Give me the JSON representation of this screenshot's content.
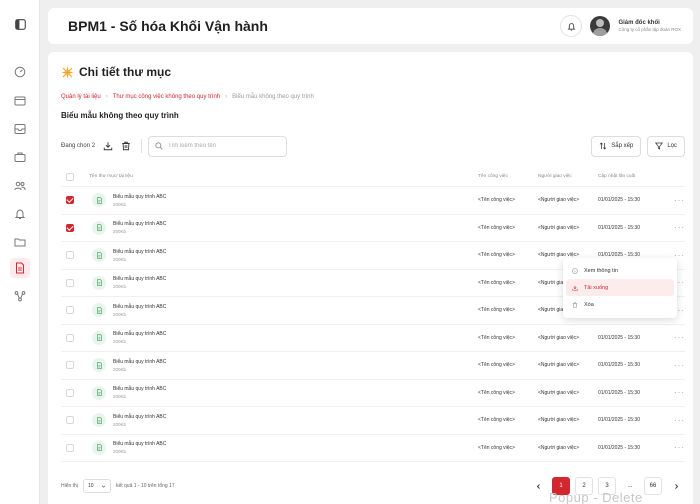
{
  "header": {
    "title": "BPM1 - Số hóa Khối Vận hành",
    "user_name": "Giám đốc khối",
    "user_org": "Công ty cổ phần tập đoàn ROX"
  },
  "page": {
    "title": "Chi tiết thư mục",
    "breadcrumb": [
      "Quản lý tài liệu",
      "Thư mục công việc không theo quy trình",
      "Biểu mẫu không theo quy trình"
    ],
    "folder_title": "Biểu mẫu không theo quy trình"
  },
  "toolbar": {
    "selected_label": "Đang chọn 2",
    "search_placeholder": "Tìm kiếm theo tên",
    "sort_label": "Sắp xếp",
    "filter_label": "Lọc"
  },
  "table": {
    "headers": {
      "name": "Tên thư mục/ tài liệu",
      "task": "Tên công việc",
      "assignee": "Người giao việc",
      "updated": "Cập nhật lần cuối"
    },
    "rows": [
      {
        "name": "Biểu mẫu quy trình ABC",
        "size": "200Kb",
        "task": "<Tên công việc>",
        "assignee": "<Người giao việc>",
        "updated": "01/01/2025 - 15:30",
        "checked": true
      },
      {
        "name": "Biểu mẫu quy trình ABC",
        "size": "200Kb",
        "task": "<Tên công việc>",
        "assignee": "<Người giao việc>",
        "updated": "01/01/2025 - 15:30",
        "checked": true
      },
      {
        "name": "Biểu mẫu quy trình ABC",
        "size": "200Kb",
        "task": "<Tên công việc>",
        "assignee": "<Người giao việc>",
        "updated": "01/01/2025 - 15:30",
        "checked": false
      },
      {
        "name": "Biểu mẫu quy trình ABC",
        "size": "200Kb",
        "task": "<Tên công việc>",
        "assignee": "<Người giao việc>",
        "updated": "01/01/2025 - 15:30",
        "checked": false
      },
      {
        "name": "Biểu mẫu quy trình ABC",
        "size": "200Kb",
        "task": "<Tên công việc>",
        "assignee": "<Người giao việc>",
        "updated": "01/01/2025 - 15:30",
        "checked": false
      },
      {
        "name": "Biểu mẫu quy trình ABC",
        "size": "200Kb",
        "task": "<Tên công việc>",
        "assignee": "<Người giao việc>",
        "updated": "01/01/2025 - 15:30",
        "checked": false
      },
      {
        "name": "Biểu mẫu quy trình ABC",
        "size": "200Kb",
        "task": "<Tên công việc>",
        "assignee": "<Người giao việc>",
        "updated": "01/01/2025 - 15:30",
        "checked": false
      },
      {
        "name": "Biểu mẫu quy trình ABC",
        "size": "200Kb",
        "task": "<Tên công việc>",
        "assignee": "<Người giao việc>",
        "updated": "01/01/2025 - 15:30",
        "checked": false
      },
      {
        "name": "Biểu mẫu quy trình ABC",
        "size": "200Kb",
        "task": "<Tên công việc>",
        "assignee": "<Người giao việc>",
        "updated": "01/01/2025 - 15:30",
        "checked": false
      },
      {
        "name": "Biểu mẫu quy trình ABC",
        "size": "200Kb",
        "task": "<Tên công việc>",
        "assignee": "<Người giao việc>",
        "updated": "01/01/2025 - 15:30",
        "checked": false
      }
    ]
  },
  "context_menu": {
    "items": [
      "Xem thông tin",
      "Tải xuống",
      "Xóa"
    ]
  },
  "footer": {
    "show_label": "Hiển thị",
    "page_size": "10",
    "result_text": "kết quả 1 - 10 trên tổng 17",
    "pages": [
      "1",
      "2",
      "3",
      "...",
      "66"
    ]
  },
  "watermark": "Popup - Delete",
  "colors": {
    "accent": "#d3272f"
  }
}
